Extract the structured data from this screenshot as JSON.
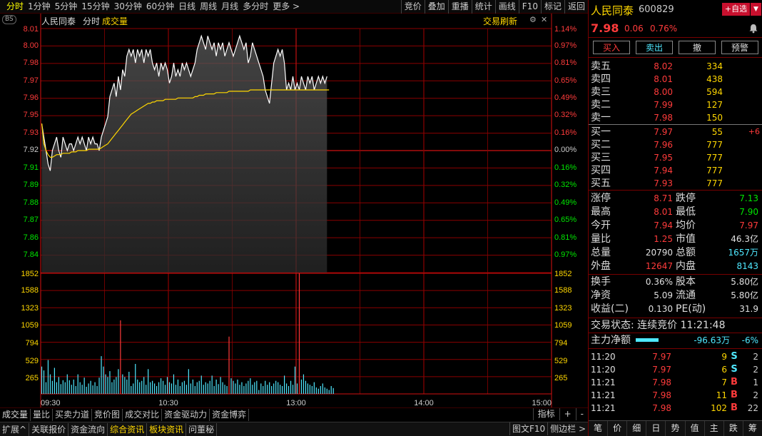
{
  "toolbar": {
    "periods": [
      "分时",
      "1分钟",
      "5分钟",
      "15分钟",
      "30分钟",
      "60分钟",
      "日线",
      "周线",
      "月线",
      "多分时",
      "更多 >"
    ],
    "active_period": 0,
    "tools": [
      "竞价",
      "叠加",
      "重播",
      "统计",
      "画线",
      "F10",
      "标记",
      "返回"
    ]
  },
  "chart_header": {
    "badge": "BS",
    "stock_name": "人民同泰",
    "mode": "分时",
    "indicator": "成交量",
    "refresh": "交易刷新"
  },
  "chart_data": {
    "type": "line",
    "x_ticks": [
      "09:30",
      "10:30",
      "13:00",
      "14:00",
      "15:00"
    ],
    "price_ticks": [
      "8.01",
      "8.00",
      "7.98",
      "7.97",
      "7.96",
      "7.95",
      "7.93",
      "7.92",
      "7.91",
      "7.89",
      "7.88",
      "7.87",
      "7.86",
      "7.84"
    ],
    "pct_ticks": [
      "1.14%",
      "0.97%",
      "0.81%",
      "0.65%",
      "0.49%",
      "0.32%",
      "0.16%",
      "0.00%",
      "0.16%",
      "0.32%",
      "0.49%",
      "0.65%",
      "0.81%",
      "0.97%"
    ],
    "volume_ticks": [
      "1852",
      "1588",
      "1323",
      "1059",
      "794",
      "529",
      "265"
    ],
    "ylim": [
      7.8345,
      8.0155
    ],
    "prev_close": 7.92,
    "x_minutes_total": 240,
    "price": [
      7.945,
      7.935,
      7.925,
      7.915,
      7.91,
      7.925,
      7.93,
      7.935,
      7.925,
      7.92,
      7.935,
      7.93,
      7.925,
      7.93,
      7.93,
      7.925,
      7.93,
      7.935,
      7.93,
      7.935,
      7.93,
      7.925,
      7.935,
      7.93,
      7.935,
      7.93,
      7.93,
      7.925,
      7.935,
      7.94,
      7.945,
      7.95,
      7.965,
      7.97,
      7.975,
      7.965,
      7.98,
      7.97,
      7.985,
      7.98,
      7.995,
      8.0,
      7.995,
      8.0,
      7.99,
      8.0,
      7.995,
      8.0,
      7.99,
      8.0,
      7.995,
      8.0,
      7.99,
      7.985,
      7.99,
      7.98,
      7.99,
      7.985,
      7.99,
      7.985,
      7.975,
      7.98,
      7.99,
      7.98,
      7.985,
      7.98,
      7.99,
      7.985,
      7.99,
      7.985,
      7.98,
      7.985,
      7.99,
      8.0,
      8.005,
      8.01,
      8.005,
      8.0,
      8.01,
      8.005,
      8.0,
      8.005,
      7.995,
      8.005,
      8.0,
      8.005,
      7.995,
      8.0,
      8.005,
      8.0,
      7.995,
      8.0,
      8.005,
      8.01,
      8.005,
      8.0,
      8.005,
      7.99,
      7.995,
      8.005,
      8.0,
      7.995,
      7.99,
      7.985,
      7.98,
      7.97,
      7.965,
      7.96,
      7.975,
      7.99,
      7.995,
      8.0,
      7.995,
      8.0,
      7.99,
      7.97,
      7.975,
      7.97,
      7.98,
      7.97,
      7.975,
      7.97,
      7.98,
      7.975,
      7.97,
      7.98,
      7.975,
      7.98,
      7.97,
      7.975,
      7.98,
      7.975,
      7.98,
      7.975,
      7.98
    ],
    "avg": [
      7.945,
      7.93,
      7.925,
      7.922,
      7.92,
      7.92,
      7.921,
      7.922,
      7.922,
      7.922,
      7.923,
      7.923,
      7.923,
      7.923,
      7.924,
      7.924,
      7.924,
      7.925,
      7.925,
      7.925,
      7.925,
      7.925,
      7.926,
      7.926,
      7.926,
      7.926,
      7.926,
      7.926,
      7.927,
      7.928,
      7.929,
      7.93,
      7.932,
      7.934,
      7.936,
      7.938,
      7.94,
      7.942,
      7.944,
      7.946,
      7.948,
      7.95,
      7.952,
      7.953,
      7.954,
      7.955,
      7.956,
      7.957,
      7.958,
      7.959,
      7.96,
      7.96,
      7.961,
      7.961,
      7.962,
      7.962,
      7.962,
      7.962,
      7.963,
      7.963,
      7.963,
      7.963,
      7.963,
      7.963,
      7.964,
      7.964,
      7.964,
      7.964,
      7.964,
      7.964,
      7.964,
      7.964,
      7.965,
      7.965,
      7.966,
      7.966,
      7.966,
      7.967,
      7.967,
      7.967,
      7.967,
      7.967,
      7.968,
      7.968,
      7.968,
      7.968,
      7.968,
      7.968,
      7.969,
      7.969,
      7.969,
      7.969,
      7.969,
      7.969,
      7.969,
      7.969,
      7.969,
      7.969,
      7.97,
      7.97,
      7.97,
      7.97,
      7.97,
      7.97,
      7.97,
      7.97,
      7.97,
      7.97,
      7.97,
      7.97,
      7.97,
      7.97,
      7.97,
      7.97,
      7.97,
      7.97,
      7.97,
      7.97,
      7.97,
      7.97,
      7.97,
      7.97,
      7.97,
      7.97,
      7.97,
      7.97,
      7.97,
      7.97,
      7.97,
      7.97,
      7.97,
      7.97,
      7.97,
      7.97,
      7.97,
      7.97
    ],
    "volume_max": 1852,
    "volume": [
      420,
      360,
      180,
      520,
      300,
      200,
      400,
      180,
      260,
      150,
      210,
      180,
      300,
      210,
      140,
      220,
      120,
      300,
      180,
      140,
      250,
      110,
      160,
      200,
      130,
      180,
      120,
      250,
      580,
      420,
      300,
      260,
      350,
      180,
      220,
      260,
      380,
      1130,
      300,
      260,
      220,
      340,
      120,
      160,
      460,
      220,
      180,
      200,
      260,
      140,
      380,
      180,
      200,
      160,
      120,
      180,
      240,
      200,
      140,
      260,
      180,
      160,
      300,
      140,
      220,
      120,
      180,
      200,
      140,
      380,
      160,
      220,
      120,
      180,
      200,
      280,
      140,
      180,
      160,
      200,
      280,
      120,
      220,
      150,
      260,
      180,
      140,
      120,
      880,
      240,
      200,
      160,
      220,
      140,
      180,
      120,
      160,
      200,
      240,
      140,
      180,
      200,
      60,
      160,
      120,
      200,
      140,
      180,
      120,
      160,
      200,
      180,
      140,
      120,
      280,
      160,
      120,
      200,
      140,
      420,
      160,
      1852,
      220,
      300,
      200,
      160,
      140,
      120,
      180,
      100,
      80,
      120,
      160,
      100,
      80,
      60,
      120,
      90
    ]
  },
  "panel": {
    "name": "人民同泰",
    "code": "600829",
    "add_btn": "+自选",
    "add_arrow": "▼",
    "price": "7.98",
    "change": "0.06",
    "pct": "0.76%",
    "trade_buttons": [
      "买入",
      "卖出",
      "撤",
      "预警"
    ],
    "asks": [
      {
        "label": "卖五",
        "price": "8.02",
        "vol": "334"
      },
      {
        "label": "卖四",
        "price": "8.01",
        "vol": "438"
      },
      {
        "label": "卖三",
        "price": "8.00",
        "vol": "594"
      },
      {
        "label": "卖二",
        "price": "7.99",
        "vol": "127"
      },
      {
        "label": "卖一",
        "price": "7.98",
        "vol": "150"
      }
    ],
    "bids": [
      {
        "label": "买一",
        "price": "7.97",
        "vol": "55",
        "chg": "+6"
      },
      {
        "label": "买二",
        "price": "7.96",
        "vol": "777",
        "chg": ""
      },
      {
        "label": "买三",
        "price": "7.95",
        "vol": "777",
        "chg": ""
      },
      {
        "label": "买四",
        "price": "7.94",
        "vol": "777",
        "chg": ""
      },
      {
        "label": "买五",
        "price": "7.93",
        "vol": "777",
        "chg": ""
      }
    ],
    "stats": [
      {
        "l1": "涨停",
        "v1": "8.71",
        "c1": "red",
        "l2": "跌停",
        "v2": "7.13",
        "c2": "green"
      },
      {
        "l1": "最高",
        "v1": "8.01",
        "c1": "red",
        "l2": "最低",
        "v2": "7.90",
        "c2": "green"
      },
      {
        "l1": "今开",
        "v1": "7.94",
        "c1": "red",
        "l2": "均价",
        "v2": "7.97",
        "c2": "red"
      },
      {
        "l1": "量比",
        "v1": "1.25",
        "c1": "red",
        "l2": "市值",
        "v2": "46.3亿",
        "c2": "white"
      },
      {
        "l1": "总量",
        "v1": "20790",
        "c1": "white",
        "l2": "总额",
        "v2": "1657万",
        "c2": "cyan"
      },
      {
        "l1": "外盘",
        "v1": "12647",
        "c1": "red",
        "l2": "内盘",
        "v2": "8143",
        "c2": "cyan"
      }
    ],
    "stats2": [
      {
        "l1": "换手",
        "v1": "0.36%",
        "c1": "white",
        "l2": "股本",
        "v2": "5.80亿",
        "c2": "white"
      },
      {
        "l1": "净资",
        "v1": "5.09",
        "c1": "white",
        "l2": "流通",
        "v2": "5.80亿",
        "c2": "white"
      },
      {
        "l1": "收益(二)",
        "v1": "0.130",
        "c1": "white",
        "l2": "PE(动)",
        "v2": "31.9",
        "c2": "white"
      }
    ],
    "trade_status": "交易状态: 连续竞价 11:21:48",
    "main_flow_label": "主力净额",
    "main_flow_value": "-96.63万",
    "main_flow_pct": "-6%",
    "ticks": [
      {
        "time": "11:20",
        "price": "7.97",
        "vol": "9",
        "dir": "S",
        "n": "2"
      },
      {
        "time": "11:20",
        "price": "7.97",
        "vol": "6",
        "dir": "S",
        "n": "2"
      },
      {
        "time": "11:21",
        "price": "7.98",
        "vol": "7",
        "dir": "B",
        "n": "1"
      },
      {
        "time": "11:21",
        "price": "7.98",
        "vol": "11",
        "dir": "B",
        "n": "2"
      },
      {
        "time": "11:21",
        "price": "7.98",
        "vol": "102",
        "dir": "B",
        "n": "22"
      }
    ],
    "bottom_nav": [
      "笔",
      "价",
      "细",
      "日",
      "势",
      "值",
      "主",
      "跌",
      "筹"
    ]
  },
  "bottom_tabs": {
    "row1": [
      "成交量",
      "量比",
      "买卖力道",
      "竞价图",
      "成交对比",
      "资金驱动力",
      "资金博弈"
    ],
    "row1_right": [
      "指标",
      "+",
      "-"
    ],
    "row2": [
      "扩展^",
      "关联报价",
      "资金流向",
      "综合资讯",
      "板块资讯",
      "问董秘"
    ],
    "row2_highlight": [
      3,
      4
    ],
    "row2_right": [
      "图文F10",
      "侧边栏 >"
    ]
  },
  "colors": {
    "up": "#ff3b3b",
    "down": "#00e600",
    "grid": "#8b0000",
    "avg": "#ffd700",
    "price": "#ffffff",
    "vol": "#4fe8ff"
  }
}
